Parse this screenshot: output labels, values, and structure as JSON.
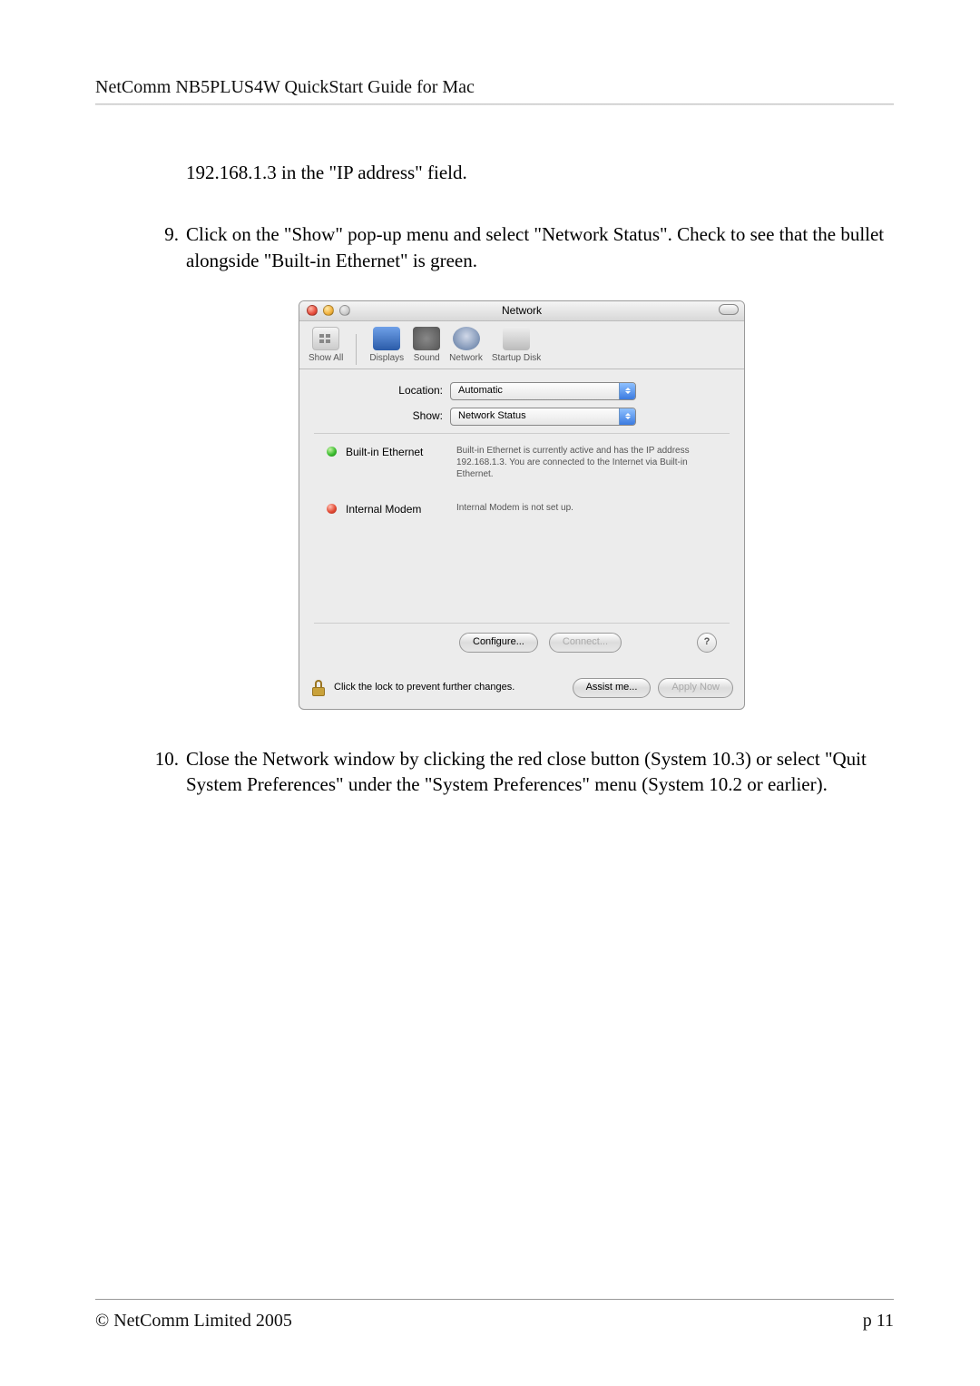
{
  "header": "NetComm NB5PLUS4W QuickStart Guide for Mac",
  "continued_line": "192.168.1.3 in the \"IP address\" field.",
  "step9": {
    "num": "9.",
    "text": "Click on the \"Show\" pop-up menu and select \"Network Status\". Check to see that the bullet alongside \"Built-in Ethernet\" is green."
  },
  "step10": {
    "num": "10.",
    "text": "Close the Network window by clicking the red close button (System 10.3) or select \"Quit System Preferences\" under the \"System Preferences\" menu (System 10.2 or earlier)."
  },
  "mac": {
    "title": "Network",
    "toolbar": {
      "showall": "Show All",
      "displays": "Displays",
      "sound": "Sound",
      "network": "Network",
      "startup": "Startup Disk"
    },
    "location_label": "Location:",
    "location_value": "Automatic",
    "show_label": "Show:",
    "show_value": "Network Status",
    "ethernet_name": "Built-in Ethernet",
    "ethernet_desc": "Built-in Ethernet is currently active and has the IP address 192.168.1.3. You are connected to the Internet via Built-in Ethernet.",
    "modem_name": "Internal Modem",
    "modem_desc": "Internal Modem is not set up.",
    "configure_btn": "Configure...",
    "connect_btn": "Connect...",
    "help": "?",
    "lock_text": "Click the lock to prevent further changes.",
    "assist_btn": "Assist me...",
    "apply_btn": "Apply Now"
  },
  "footer": {
    "left": "© NetComm Limited 2005",
    "right": "p 11"
  }
}
